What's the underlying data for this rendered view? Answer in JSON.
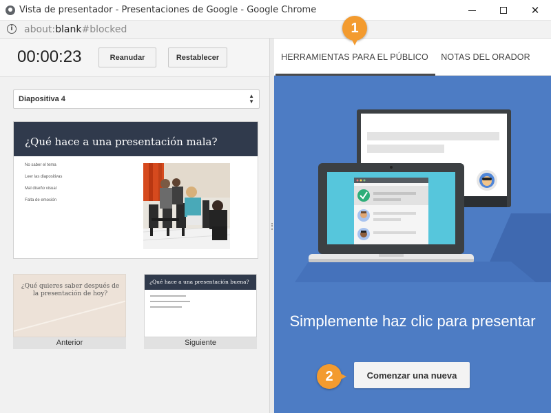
{
  "window": {
    "title": "Vista de presentador - Presentaciones de Google - Google Chrome",
    "minimize_icon": "minimize-icon",
    "maximize_icon": "maximize-icon",
    "close_icon": "close-icon",
    "close_glyph": "✕"
  },
  "address": {
    "info_glyph": "i",
    "scheme": "about:",
    "host": "blank",
    "rest": "#blocked"
  },
  "controls": {
    "timer": "00:00:23",
    "resume_label": "Reanudar",
    "reset_label": "Restablecer"
  },
  "slide_selector": {
    "selected": "Diapositiva 4",
    "arrows": "▲▼"
  },
  "current_slide": {
    "title": "¿Qué hace a una presentación mala?",
    "bullets": [
      "No saber el tema",
      "Leer las diapositivas",
      "Mal diseño visual",
      "Falta de emoción"
    ]
  },
  "previous_slide": {
    "text": "¿Qué quieres saber después de la presentación de hoy?",
    "caption": "Anterior"
  },
  "next_slide": {
    "title": "¿Qué hace a una presentación buena?",
    "caption": "Siguiente"
  },
  "tabs": {
    "tools": "HERRAMIENTAS PARA EL PÚBLICO",
    "notes": "NOTAS DEL ORADOR"
  },
  "audience": {
    "cta": "Simplemente haz clic para presentar",
    "start_button": "Comenzar una nueva"
  },
  "callouts": {
    "one": "1",
    "two": "2"
  },
  "colors": {
    "accent_blue": "#4d7cc4",
    "slide_header": "#303a4c",
    "callout_orange": "#f39b2f"
  }
}
